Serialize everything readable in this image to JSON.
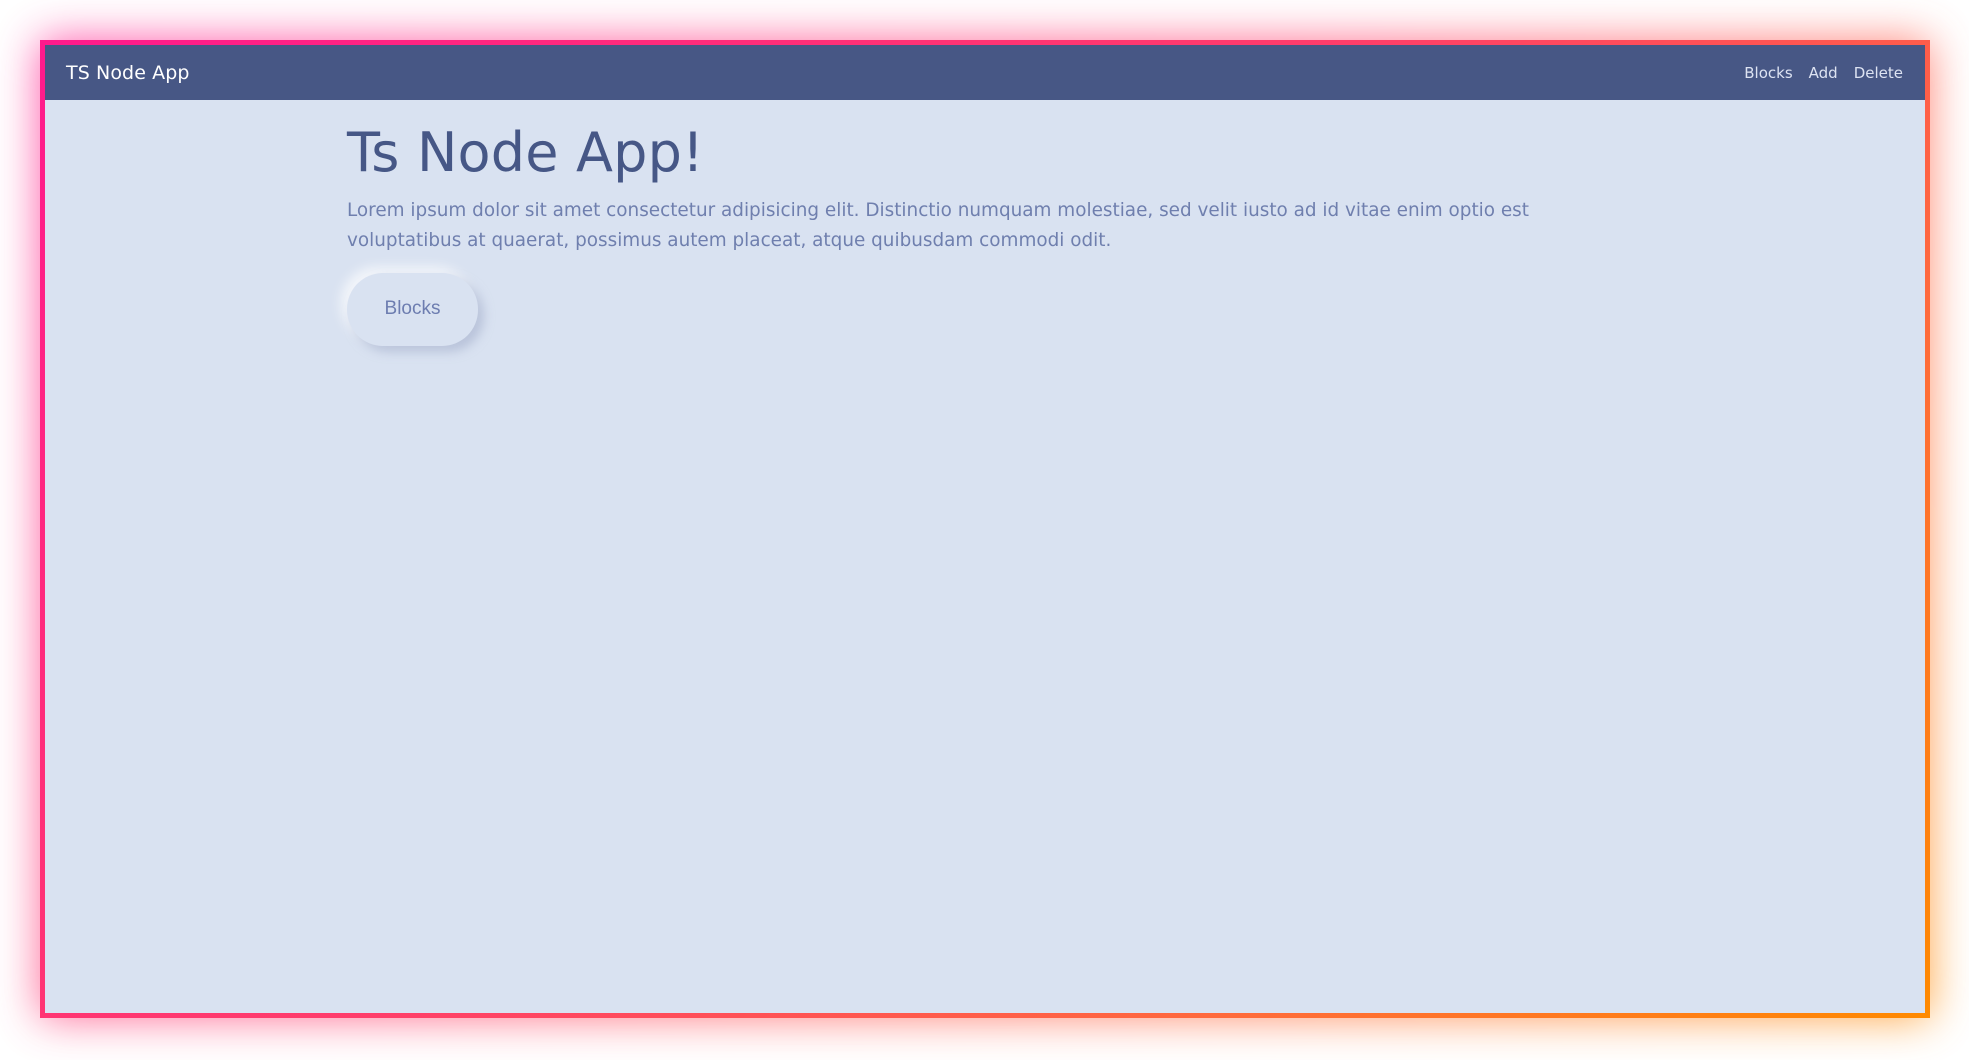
{
  "navbar": {
    "brand": "TS Node App",
    "links": [
      "Blocks",
      "Add",
      "Delete"
    ]
  },
  "hero": {
    "title": "Ts Node App!",
    "description": "Lorem ipsum dolor sit amet consectetur adipisicing elit. Distinctio numquam molestiae, sed velit iusto ad id vitae enim optio est voluptatibus at quaerat, possimus autem placeat, atque quibusdam commodi odit.",
    "button_label": "Blocks"
  },
  "colors": {
    "navbar_bg": "#475785",
    "page_bg": "#d9e2f1",
    "frame_gradient_start": "#ff1a8c",
    "frame_gradient_end": "#ff8a00",
    "title_color": "#465786",
    "text_color": "#6f7fae"
  }
}
